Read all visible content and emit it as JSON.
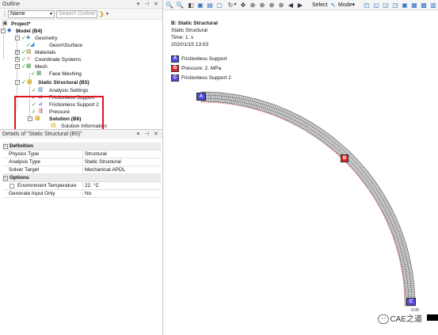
{
  "outline": {
    "title": "Outline",
    "controls": "▾ ⊣ ✕",
    "name_value": "Name",
    "search_placeholder": "Search Outline",
    "tree": [
      {
        "label": "Project*"
      },
      {
        "label": "Model (B4)"
      },
      {
        "label": "Geometry"
      },
      {
        "label": "Geom\\Surface"
      },
      {
        "label": "Materials"
      },
      {
        "label": "Coordinate Systems"
      },
      {
        "label": "Mesh"
      },
      {
        "label": "Face Meshing"
      },
      {
        "label": "Static Structural (B5)"
      },
      {
        "label": "Analysis Settings"
      },
      {
        "label": "Frictionless Support"
      },
      {
        "label": "Frictionless Support 2"
      },
      {
        "label": "Pressure"
      },
      {
        "label": "Solution (B6)"
      },
      {
        "label": "Solution Information"
      }
    ]
  },
  "details": {
    "title": "Details of \"Static Structural (B5)\"",
    "controls": "▾ ⊣ ✕",
    "sections": [
      {
        "name": "Definition",
        "rows": [
          {
            "key": "Physics Type",
            "value": "Structural"
          },
          {
            "key": "Analysis Type",
            "value": "Static Structural"
          },
          {
            "key": "Solver Target",
            "value": "Mechanical APDL"
          }
        ]
      },
      {
        "name": "Options",
        "rows": [
          {
            "key": "Environment Temperature",
            "value": "22. °C"
          },
          {
            "key": "Generate Input Only",
            "value": "No"
          }
        ]
      }
    ]
  },
  "toolbar": {
    "select_label": "Select",
    "mode_label": "Mode▾"
  },
  "viewport": {
    "header": {
      "title": "B: Static Structural",
      "subtitle": "Static Structural",
      "time": "Time: 1. s",
      "date": "2020/1/15 13:03"
    },
    "legend": [
      {
        "letter": "A",
        "label": "Frictionless Support",
        "color": "#4a4ae0"
      },
      {
        "letter": "B",
        "label": "Pressure: 2. MPa",
        "color": "#e02a2a"
      },
      {
        "letter": "C",
        "label": "Frictionless Support 2",
        "color": "#5a4ae0"
      }
    ],
    "markers": {
      "a": "A",
      "b": "B",
      "c": "C"
    },
    "scale_text": "0.00",
    "watermark": "CAE之道",
    "mesh_color": "#555555",
    "pressure_color": "#e02a2a"
  }
}
